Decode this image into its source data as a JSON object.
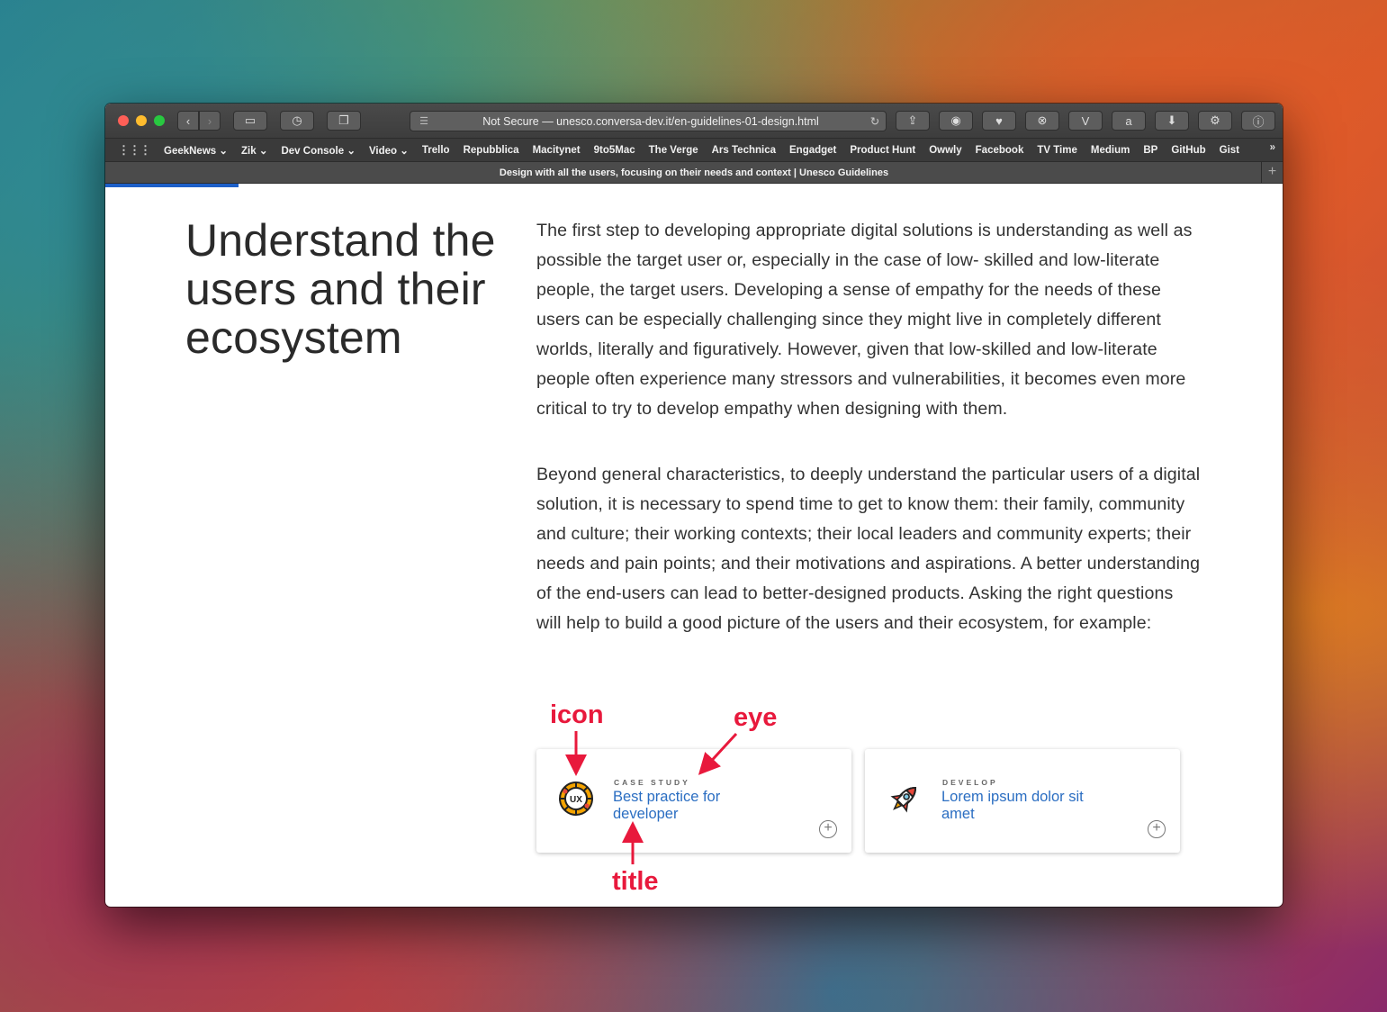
{
  "browser": {
    "url_text": "Not Secure — unesco.conversa-dev.it/en-guidelines-01-design.html",
    "tab_title": "Design with all the users, focusing on their needs and context | Unesco Guidelines",
    "bookmarks": [
      "GeekNews ⌄",
      "Zik ⌄",
      "Dev Console ⌄",
      "Video ⌄",
      "Trello",
      "Repubblica",
      "Macitynet",
      "9to5Mac",
      "The Verge",
      "Ars Technica",
      "Engadget",
      "Product Hunt",
      "Owwly",
      "Facebook",
      "TV Time",
      "Medium",
      "BP",
      "GitHub",
      "Gist"
    ],
    "more_bookmarks": "»",
    "new_tab": "+"
  },
  "page": {
    "heading": "Understand the users and their ecosystem",
    "paragraphs": [
      "The first step to developing appropriate digital solutions is understanding as well as possible the target user or, especially in the case of low- skilled and low-literate people, the target users. Developing a sense of empathy for the needs of these users can be especially challenging since they might live in completely different worlds, literally and figuratively. However, given that low-skilled and low-literate people often experience many stressors and vulnerabilities, it becomes even more critical to try to develop empathy when designing with them.",
      "Beyond general characteristics, to deeply understand the particular users of a digital solution, it is necessary to spend time to get to know them: their family, community and culture; their working contexts; their local leaders and community experts; their needs and pain points; and their motivations and aspirations. A better understanding of the end-users can lead to better-designed products. Asking the right questions will help to build a good picture of the users and their ecosystem, for example:"
    ],
    "cards": [
      {
        "eyebrow": "CASE STUDY",
        "title": "Best practice for developer",
        "icon": "ux-badge-icon"
      },
      {
        "eyebrow": "DEVELOP",
        "title": "Lorem ipsum dolor sit amet",
        "icon": "rocket-icon"
      }
    ]
  },
  "annotations": {
    "icon": "icon",
    "eye": "eye",
    "title": "title"
  },
  "colors": {
    "link": "#2b6ec2",
    "progress": "#1d5fc8",
    "annotation": "#e8193c"
  }
}
